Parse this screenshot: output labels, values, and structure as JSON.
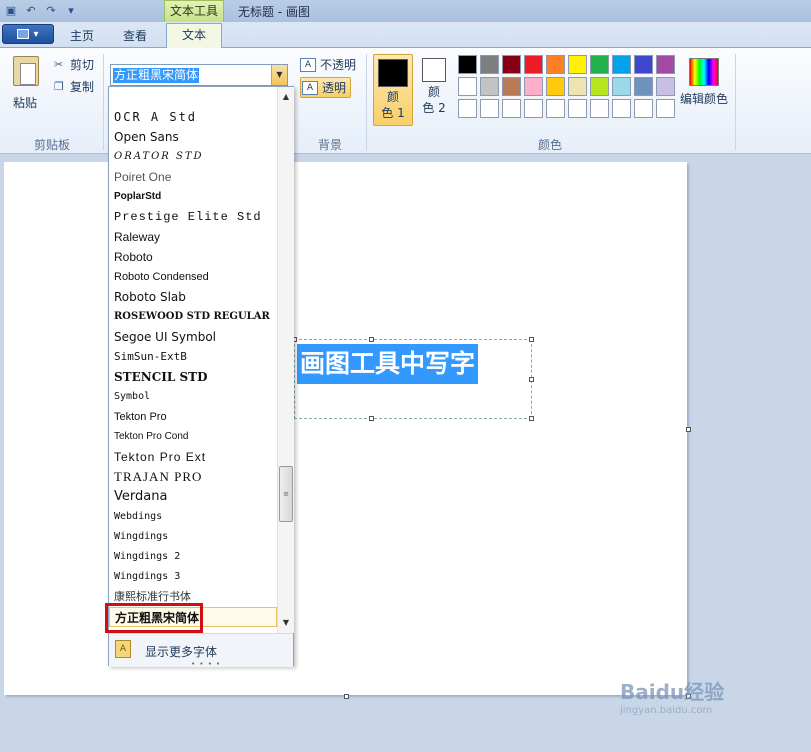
{
  "window": {
    "title": "无标题 - 画图",
    "context_tab_title": "文本工具"
  },
  "quick_access": {
    "icons": [
      "save-icon",
      "undo-icon",
      "redo-icon",
      "customize-icon"
    ]
  },
  "tabs": [
    {
      "label": "主页"
    },
    {
      "label": "查看"
    },
    {
      "label": "文本",
      "active": true
    }
  ],
  "clipboard": {
    "paste_label": "粘贴",
    "cut_label": "剪切",
    "copy_label": "复制",
    "group_label": "剪贴板"
  },
  "font": {
    "current_value": "方正粗黑宋简体"
  },
  "background": {
    "opaque_label": "不透明",
    "transparent_label": "透明",
    "group_label": "背景"
  },
  "colors": {
    "color1_label_line1": "颜",
    "color1_label_line2": "色 1",
    "color2_label_line1": "颜",
    "color2_label_line2": "色 2",
    "edit_label": "编辑颜色",
    "group_label": "颜色",
    "color1": "#000000",
    "color2": "#ffffff",
    "palette_row1": [
      "#000000",
      "#7f7f7f",
      "#880015",
      "#ed1c24",
      "#ff7f27",
      "#fff200",
      "#22b14c",
      "#00a2e8",
      "#3f48cc",
      "#a349a4"
    ],
    "palette_row2": [
      "#ffffff",
      "#c3c3c3",
      "#b97a57",
      "#ffaec9",
      "#ffc90e",
      "#efe4b0",
      "#b5e61d",
      "#99d9ea",
      "#7092be",
      "#c8bfe7"
    ],
    "palette_row3": [
      "#ffffff",
      "#ffffff",
      "#ffffff",
      "#ffffff",
      "#ffffff",
      "#ffffff",
      "#ffffff",
      "#ffffff",
      "#ffffff",
      "#ffffff"
    ]
  },
  "canvas": {
    "text": "画图工具中写字"
  },
  "font_dropdown": {
    "items": [
      "OCR A Std",
      "Open Sans",
      "ORATOR STD",
      "Poiret One",
      "PoplarStd",
      "Prestige Elite Std",
      "Raleway",
      "Roboto",
      "Roboto Condensed",
      "Roboto Slab",
      "ROSEWOOD STD REGULAR",
      "Segoe UI Symbol",
      "SimSun-ExtB",
      "STENCIL STD",
      "Symbol",
      "Tekton Pro",
      "Tekton Pro Cond",
      "Tekton Pro Ext",
      "TRAJAN PRO",
      "Verdana",
      "Webdings",
      "Wingdings",
      "Wingdings 2",
      "Wingdings 3",
      "康熙标准行书体",
      "方正粗黑宋简体"
    ],
    "more_fonts_label": "显示更多字体"
  },
  "watermark": {
    "brand": "Baidu经验",
    "url": "jingyan.baidu.com"
  }
}
